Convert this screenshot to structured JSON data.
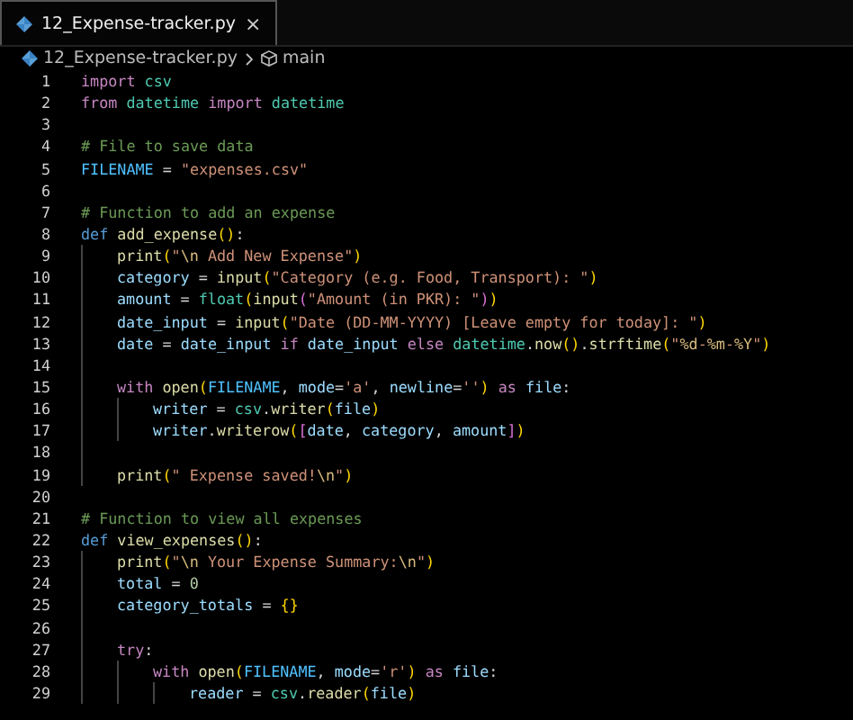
{
  "tabs": [
    {
      "label": "12_Expense-tracker.py",
      "close": "×",
      "selected": true
    }
  ],
  "breadcrumb": [
    {
      "kind": "file",
      "label": "12_Expense-tracker.py"
    },
    {
      "kind": "symbol",
      "label": "main"
    }
  ],
  "lines": [
    {
      "number": "1",
      "tokens": [
        {
          "kind": "kw",
          "text": "import "
        },
        {
          "kind": "mod",
          "text": "csv"
        }
      ]
    },
    {
      "number": "2",
      "tokens": [
        {
          "kind": "kw",
          "text": "from "
        },
        {
          "kind": "mod",
          "text": "datetime "
        },
        {
          "kind": "kw",
          "text": "import "
        },
        {
          "kind": "mod",
          "text": "datetime"
        }
      ]
    },
    {
      "number": "3"
    },
    {
      "number": "4",
      "tokens": [
        {
          "kind": "cm",
          "text": "# File to save data"
        }
      ]
    },
    {
      "number": "5",
      "tokens": [
        {
          "kind": "const",
          "text": "FILENAME "
        },
        {
          "kind": "op",
          "text": "= "
        },
        {
          "kind": "str",
          "text": "\"expenses.csv\""
        }
      ]
    },
    {
      "number": "6"
    },
    {
      "number": "7",
      "tokens": [
        {
          "kind": "cm",
          "text": "# Function to add an expense"
        }
      ]
    },
    {
      "number": "8",
      "tokens": [
        {
          "kind": "def",
          "text": "def "
        },
        {
          "kind": "fn",
          "text": "add_expense"
        },
        {
          "kind": "p1",
          "text": "()"
        },
        {
          "kind": "op",
          "text": ":"
        }
      ],
      "children": [
        {
          "number": "9",
          "tokens": [
            {
              "kind": "fn",
              "text": "print"
            },
            {
              "kind": "p1",
              "text": "("
            },
            {
              "kind": "str",
              "text": "\""
            },
            {
              "kind": "esc",
              "text": "\\n"
            },
            {
              "kind": "str",
              "text": " Add New Expense\""
            },
            {
              "kind": "p1",
              "text": ")"
            }
          ]
        },
        {
          "number": "10",
          "tokens": [
            {
              "kind": "var",
              "text": "category "
            },
            {
              "kind": "op",
              "text": "= "
            },
            {
              "kind": "fn",
              "text": "input"
            },
            {
              "kind": "p1",
              "text": "("
            },
            {
              "kind": "str",
              "text": "\"Category (e.g. Food, Transport): \""
            },
            {
              "kind": "p1",
              "text": ")"
            }
          ]
        },
        {
          "number": "11",
          "tokens": [
            {
              "kind": "var",
              "text": "amount "
            },
            {
              "kind": "op",
              "text": "= "
            },
            {
              "kind": "mod",
              "text": "float"
            },
            {
              "kind": "p1",
              "text": "("
            },
            {
              "kind": "fn",
              "text": "input"
            },
            {
              "kind": "p2",
              "text": "("
            },
            {
              "kind": "str",
              "text": "\"Amount (in PKR): \""
            },
            {
              "kind": "p2",
              "text": ")"
            },
            {
              "kind": "p1",
              "text": ")"
            }
          ]
        },
        {
          "number": "12",
          "tokens": [
            {
              "kind": "var",
              "text": "date_input "
            },
            {
              "kind": "op",
              "text": "= "
            },
            {
              "kind": "fn",
              "text": "input"
            },
            {
              "kind": "p1",
              "text": "("
            },
            {
              "kind": "str",
              "text": "\"Date (DD-MM-YYYY) [Leave empty for today]: \""
            },
            {
              "kind": "p1",
              "text": ")"
            }
          ]
        },
        {
          "number": "13",
          "tokens": [
            {
              "kind": "var",
              "text": "date "
            },
            {
              "kind": "op",
              "text": "= "
            },
            {
              "kind": "var",
              "text": "date_input "
            },
            {
              "kind": "kw",
              "text": "if "
            },
            {
              "kind": "var",
              "text": "date_input "
            },
            {
              "kind": "kw",
              "text": "else "
            },
            {
              "kind": "mod",
              "text": "datetime"
            },
            {
              "kind": "op",
              "text": "."
            },
            {
              "kind": "fn",
              "text": "now"
            },
            {
              "kind": "p1",
              "text": "()"
            },
            {
              "kind": "op",
              "text": "."
            },
            {
              "kind": "fn",
              "text": "strftime"
            },
            {
              "kind": "p1",
              "text": "("
            },
            {
              "kind": "str",
              "text": "\""
            },
            {
              "kind": "esc",
              "text": "%d"
            },
            {
              "kind": "str",
              "text": "-"
            },
            {
              "kind": "esc",
              "text": "%m"
            },
            {
              "kind": "str",
              "text": "-"
            },
            {
              "kind": "esc",
              "text": "%Y"
            },
            {
              "kind": "str",
              "text": "\""
            },
            {
              "kind": "p1",
              "text": ")"
            }
          ]
        },
        {
          "number": "14"
        },
        {
          "number": "15",
          "tokens": [
            {
              "kind": "kw",
              "text": "with "
            },
            {
              "kind": "fn",
              "text": "open"
            },
            {
              "kind": "p1",
              "text": "("
            },
            {
              "kind": "const",
              "text": "FILENAME"
            },
            {
              "kind": "op",
              "text": ", "
            },
            {
              "kind": "var",
              "text": "mode"
            },
            {
              "kind": "op",
              "text": "="
            },
            {
              "kind": "str",
              "text": "'a'"
            },
            {
              "kind": "op",
              "text": ", "
            },
            {
              "kind": "var",
              "text": "newline"
            },
            {
              "kind": "op",
              "text": "="
            },
            {
              "kind": "str",
              "text": "''"
            },
            {
              "kind": "p1",
              "text": ") "
            },
            {
              "kind": "kw",
              "text": "as "
            },
            {
              "kind": "var",
              "text": "file"
            },
            {
              "kind": "op",
              "text": ":"
            }
          ],
          "children": [
            {
              "number": "16",
              "tokens": [
                {
                  "kind": "var",
                  "text": "writer "
                },
                {
                  "kind": "op",
                  "text": "= "
                },
                {
                  "kind": "mod",
                  "text": "csv"
                },
                {
                  "kind": "op",
                  "text": "."
                },
                {
                  "kind": "fn",
                  "text": "writer"
                },
                {
                  "kind": "p1",
                  "text": "("
                },
                {
                  "kind": "var",
                  "text": "file"
                },
                {
                  "kind": "p1",
                  "text": ")"
                }
              ]
            },
            {
              "number": "17",
              "tokens": [
                {
                  "kind": "var",
                  "text": "writer"
                },
                {
                  "kind": "op",
                  "text": "."
                },
                {
                  "kind": "fn",
                  "text": "writerow"
                },
                {
                  "kind": "p1",
                  "text": "("
                },
                {
                  "kind": "p2",
                  "text": "["
                },
                {
                  "kind": "var",
                  "text": "date"
                },
                {
                  "kind": "op",
                  "text": ", "
                },
                {
                  "kind": "var",
                  "text": "category"
                },
                {
                  "kind": "op",
                  "text": ", "
                },
                {
                  "kind": "var",
                  "text": "amount"
                },
                {
                  "kind": "p2",
                  "text": "]"
                },
                {
                  "kind": "p1",
                  "text": ")"
                }
              ]
            }
          ]
        },
        {
          "number": "18"
        },
        {
          "number": "19",
          "tokens": [
            {
              "kind": "fn",
              "text": "print"
            },
            {
              "kind": "p1",
              "text": "("
            },
            {
              "kind": "str",
              "text": "\" Expense saved!"
            },
            {
              "kind": "esc",
              "text": "\\n"
            },
            {
              "kind": "str",
              "text": "\""
            },
            {
              "kind": "p1",
              "text": ")"
            }
          ]
        }
      ]
    },
    {
      "number": "20"
    },
    {
      "number": "21",
      "tokens": [
        {
          "kind": "cm",
          "text": "# Function to view all expenses"
        }
      ]
    },
    {
      "number": "22",
      "tokens": [
        {
          "kind": "def",
          "text": "def "
        },
        {
          "kind": "fn",
          "text": "view_expenses"
        },
        {
          "kind": "p1",
          "text": "()"
        },
        {
          "kind": "op",
          "text": ":"
        }
      ],
      "children": [
        {
          "number": "23",
          "tokens": [
            {
              "kind": "fn",
              "text": "print"
            },
            {
              "kind": "p1",
              "text": "("
            },
            {
              "kind": "str",
              "text": "\""
            },
            {
              "kind": "esc",
              "text": "\\n"
            },
            {
              "kind": "str",
              "text": " Your Expense Summary:"
            },
            {
              "kind": "esc",
              "text": "\\n"
            },
            {
              "kind": "str",
              "text": "\""
            },
            {
              "kind": "p1",
              "text": ")"
            }
          ]
        },
        {
          "number": "24",
          "tokens": [
            {
              "kind": "var",
              "text": "total "
            },
            {
              "kind": "op",
              "text": "= "
            },
            {
              "kind": "num",
              "text": "0"
            }
          ]
        },
        {
          "number": "25",
          "tokens": [
            {
              "kind": "var",
              "text": "category_totals "
            },
            {
              "kind": "op",
              "text": "= "
            },
            {
              "kind": "p1",
              "text": "{}"
            }
          ]
        },
        {
          "number": "26"
        },
        {
          "number": "27",
          "tokens": [
            {
              "kind": "kw",
              "text": "try"
            },
            {
              "kind": "op",
              "text": ":"
            }
          ],
          "children": [
            {
              "number": "28",
              "tokens": [
                {
                  "kind": "kw",
                  "text": "with "
                },
                {
                  "kind": "fn",
                  "text": "open"
                },
                {
                  "kind": "p1",
                  "text": "("
                },
                {
                  "kind": "const",
                  "text": "FILENAME"
                },
                {
                  "kind": "op",
                  "text": ", "
                },
                {
                  "kind": "var",
                  "text": "mode"
                },
                {
                  "kind": "op",
                  "text": "="
                },
                {
                  "kind": "str",
                  "text": "'r'"
                },
                {
                  "kind": "p1",
                  "text": ") "
                },
                {
                  "kind": "kw",
                  "text": "as "
                },
                {
                  "kind": "var",
                  "text": "file"
                },
                {
                  "kind": "op",
                  "text": ":"
                }
              ],
              "children": [
                {
                  "number": "29",
                  "tokens": [
                    {
                      "kind": "var",
                      "text": "reader "
                    },
                    {
                      "kind": "op",
                      "text": "= "
                    },
                    {
                      "kind": "mod",
                      "text": "csv"
                    },
                    {
                      "kind": "op",
                      "text": "."
                    },
                    {
                      "kind": "fn",
                      "text": "reader"
                    },
                    {
                      "kind": "p1",
                      "text": "("
                    },
                    {
                      "kind": "var",
                      "text": "file"
                    },
                    {
                      "kind": "p1",
                      "text": ")"
                    }
                  ]
                }
              ]
            }
          ]
        }
      ]
    }
  ]
}
